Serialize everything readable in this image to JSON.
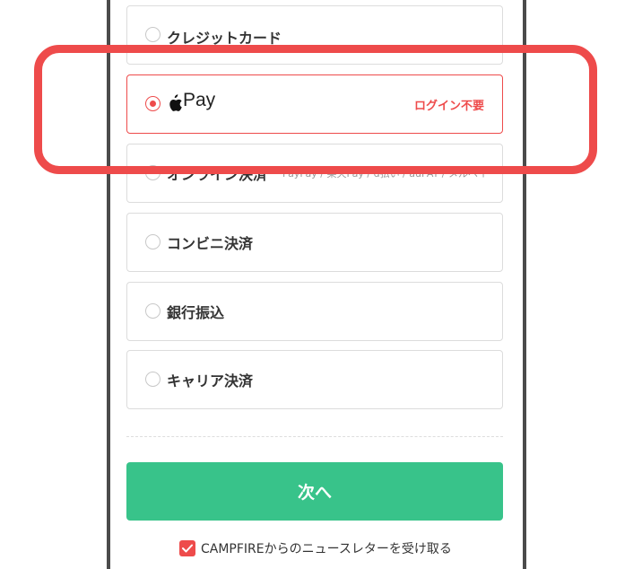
{
  "payment_options": [
    {
      "label": "クレジットカード",
      "selected": false
    },
    {
      "label": "Pay",
      "badge": "ログイン不要",
      "selected": true,
      "icon": "apple-logo"
    },
    {
      "label": "オンライン決済",
      "sub": "PayPay / 楽天Pay / d払い / auPAY / メルペイ",
      "selected": false
    },
    {
      "label": "コンビニ決済",
      "selected": false
    },
    {
      "label": "銀行振込",
      "selected": false
    },
    {
      "label": "キャリア決済",
      "selected": false
    }
  ],
  "next_button": {
    "label": "次へ",
    "color": "#38c38a"
  },
  "newsletter": {
    "label": "CAMPFIREからのニュースレターを受け取る",
    "checked": true
  },
  "colors": {
    "accent": "#ee4b4b",
    "border": "#dcdcdc",
    "frame": "#4b4b4b"
  }
}
